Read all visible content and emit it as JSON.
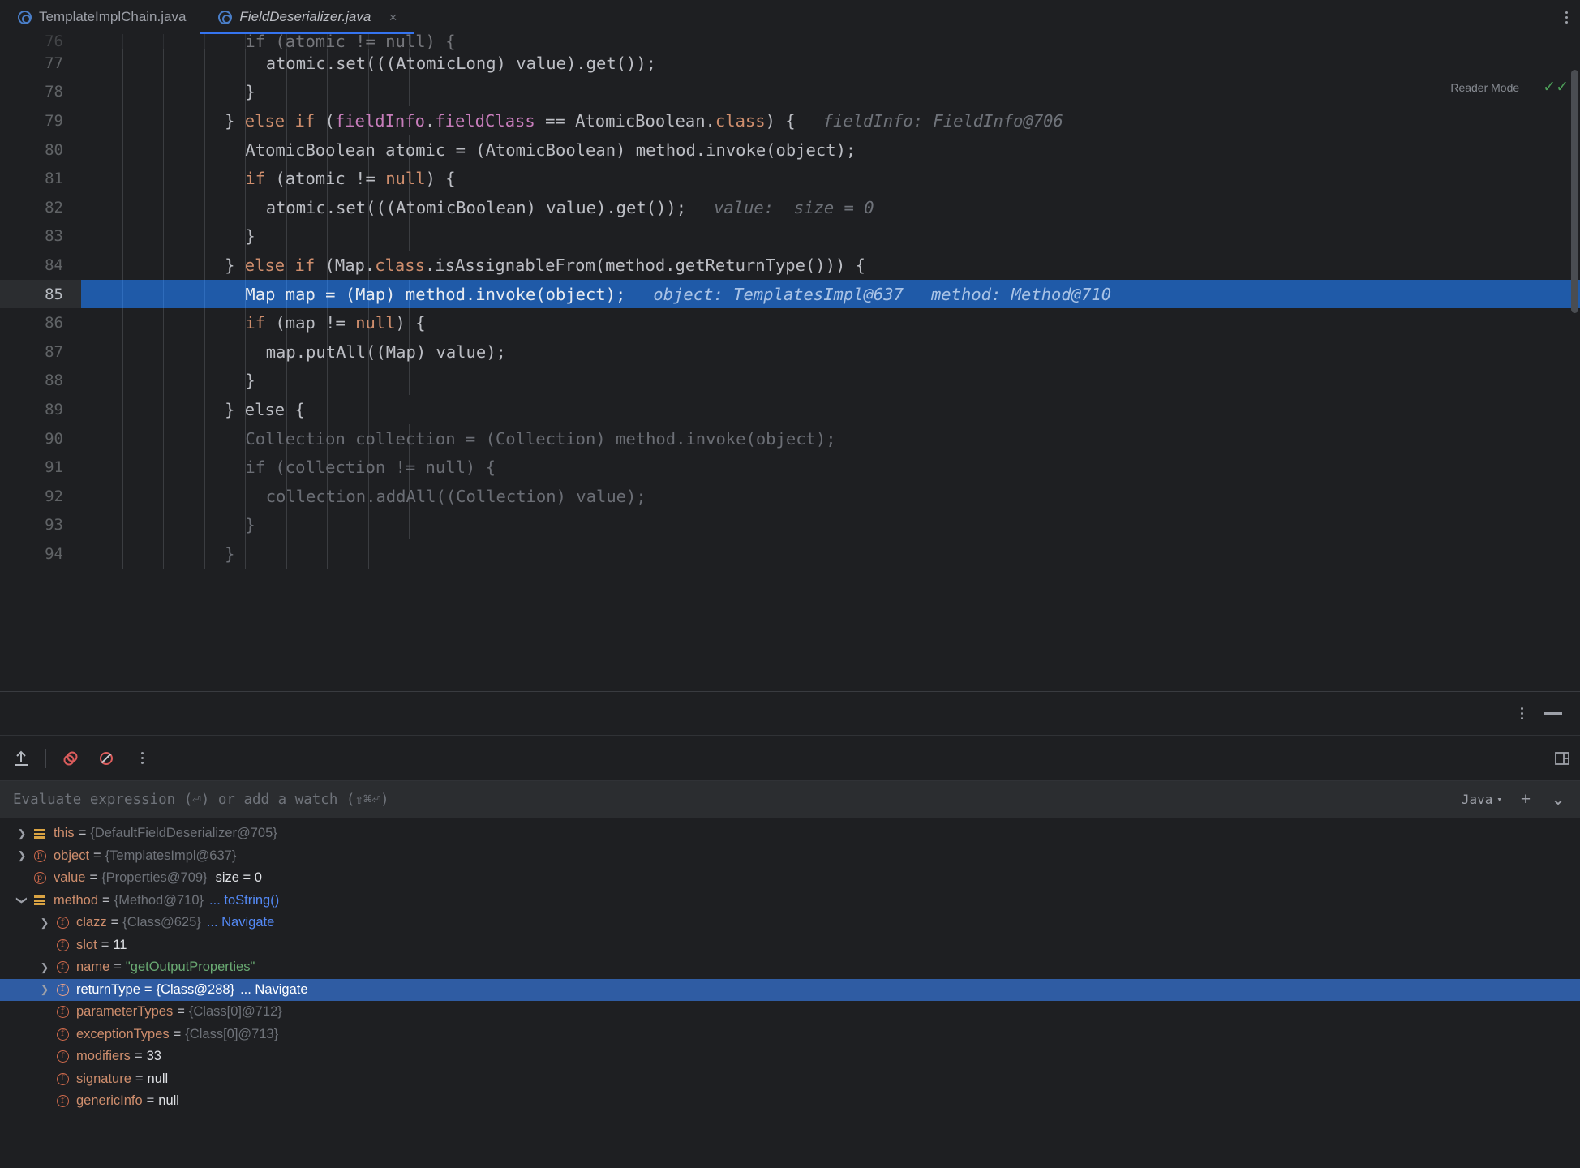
{
  "window": {
    "title": "IntelliJ IDEA Debugger"
  },
  "tabs": [
    {
      "label": "TemplateImplChain.java",
      "icon": "java-class-icon",
      "active": false,
      "closable": false
    },
    {
      "label": "FieldDeserializer.java",
      "icon": "java-class-icon",
      "active": true,
      "closable": true,
      "close_label": "×"
    }
  ],
  "tabbar": {
    "more_label": "more-tabs"
  },
  "editor": {
    "reader_mode_label": "Reader Mode",
    "reader_mode_check": "✓✓",
    "lines": [
      {
        "num": "76",
        "clipped": true,
        "indent": 8,
        "tokens": [
          {
            "t": "if (atomic != null) {",
            "c": "pln"
          }
        ],
        "hint": ""
      },
      {
        "num": "77",
        "indent": 9,
        "tokens": [
          {
            "t": "atomic.set(((AtomicLong) value).get());",
            "c": "pln"
          }
        ],
        "hint": ""
      },
      {
        "num": "78",
        "indent": 8,
        "tokens": [
          {
            "t": "}",
            "c": "pln"
          }
        ],
        "hint": ""
      },
      {
        "num": "79",
        "indent": 7,
        "tokens": [
          {
            "t": "} ",
            "c": "pln"
          },
          {
            "t": "else if",
            "c": "kw"
          },
          {
            "t": " (",
            "c": "pln"
          },
          {
            "t": "fieldInfo",
            "c": "fld"
          },
          {
            "t": ".",
            "c": "pln"
          },
          {
            "t": "fieldClass",
            "c": "fld"
          },
          {
            "t": " == AtomicBoolean.",
            "c": "pln"
          },
          {
            "t": "class",
            "c": "kw"
          },
          {
            "t": ") {",
            "c": "pln"
          }
        ],
        "hint": "fieldInfo: FieldInfo@706"
      },
      {
        "num": "80",
        "indent": 8,
        "tokens": [
          {
            "t": "AtomicBoolean atomic = (AtomicBoolean) method.invoke(object);",
            "c": "pln"
          }
        ],
        "hint": ""
      },
      {
        "num": "81",
        "indent": 8,
        "tokens": [
          {
            "t": "if",
            "c": "kw"
          },
          {
            "t": " (atomic != ",
            "c": "pln"
          },
          {
            "t": "null",
            "c": "kw"
          },
          {
            "t": ") {",
            "c": "pln"
          }
        ],
        "hint": ""
      },
      {
        "num": "82",
        "indent": 9,
        "tokens": [
          {
            "t": "atomic.set(((AtomicBoolean) value).get());",
            "c": "pln"
          }
        ],
        "hint": "value:  size = 0"
      },
      {
        "num": "83",
        "indent": 8,
        "tokens": [
          {
            "t": "}",
            "c": "pln"
          }
        ],
        "hint": ""
      },
      {
        "num": "84",
        "indent": 7,
        "tokens": [
          {
            "t": "} ",
            "c": "pln"
          },
          {
            "t": "else if",
            "c": "kw"
          },
          {
            "t": " (Map.",
            "c": "pln"
          },
          {
            "t": "class",
            "c": "kw"
          },
          {
            "t": ".isAssignableFrom(method.getReturnType())) {",
            "c": "pln"
          }
        ],
        "hint": ""
      },
      {
        "num": "85",
        "indent": 8,
        "highlight": true,
        "tokens": [
          {
            "t": "Map map = (Map) method.invoke(object);",
            "c": "pln"
          }
        ],
        "hint": "object: TemplatesImpl@637",
        "hint2": "method: Method@710"
      },
      {
        "num": "86",
        "indent": 8,
        "tokens": [
          {
            "t": "if",
            "c": "kw"
          },
          {
            "t": " (map != ",
            "c": "pln"
          },
          {
            "t": "null",
            "c": "kw"
          },
          {
            "t": ") {",
            "c": "pln"
          }
        ],
        "hint": ""
      },
      {
        "num": "87",
        "indent": 9,
        "tokens": [
          {
            "t": "map.putAll((Map) value);",
            "c": "pln"
          }
        ],
        "hint": ""
      },
      {
        "num": "88",
        "indent": 8,
        "tokens": [
          {
            "t": "}",
            "c": "pln"
          }
        ],
        "hint": ""
      },
      {
        "num": "89",
        "indent": 7,
        "tokens": [
          {
            "t": "} ",
            "c": "pln"
          },
          {
            "t": "else",
            "c": "pln"
          },
          {
            "t": " {",
            "c": "pln"
          }
        ],
        "hint": ""
      },
      {
        "num": "90",
        "indent": 8,
        "dim": true,
        "tokens": [
          {
            "t": "Collection collection = (Collection) method.invoke(object);",
            "c": "dim"
          }
        ],
        "hint": ""
      },
      {
        "num": "91",
        "indent": 8,
        "dim": true,
        "tokens": [
          {
            "t": "if (collection != null) {",
            "c": "dim"
          }
        ],
        "hint": ""
      },
      {
        "num": "92",
        "indent": 9,
        "dim": true,
        "tokens": [
          {
            "t": "collection.addAll((Collection) value);",
            "c": "dim"
          }
        ],
        "hint": ""
      },
      {
        "num": "93",
        "indent": 8,
        "dim": true,
        "tokens": [
          {
            "t": "}",
            "c": "dim"
          }
        ],
        "hint": ""
      },
      {
        "num": "94",
        "indent": 7,
        "dim": true,
        "tokens": [
          {
            "t": "}",
            "c": "dim"
          }
        ],
        "hint": ""
      }
    ]
  },
  "debugger": {
    "panel_more_label": "options",
    "minimize_label": "minimize",
    "toolbar": [
      {
        "name": "step-out-icon",
        "glyph": "↑"
      },
      {
        "name": "view-breakpoints-icon",
        "glyph": "○"
      },
      {
        "name": "mute-breakpoints-icon",
        "glyph": "⊘"
      },
      {
        "name": "more-options-icon",
        "glyph": "⋮"
      }
    ],
    "layout_icon": "layout-settings-icon",
    "evaluate": {
      "placeholder": "Evaluate expression (⏎) or add a watch (⇧⌘⏎)",
      "language": "Java",
      "add_watch_label": "+",
      "expand_label": "⌄"
    },
    "variables": [
      {
        "depth": 0,
        "expandable": true,
        "expanded": false,
        "icon": "frame-icon",
        "name": "this",
        "eq": "=",
        "value": "{DefaultFieldDeserializer@705}",
        "value_class": "vval-dim"
      },
      {
        "depth": 0,
        "expandable": true,
        "expanded": false,
        "icon": "parameter-icon",
        "name": "object",
        "eq": "=",
        "value": "{TemplatesImpl@637}",
        "value_class": "vval-dim"
      },
      {
        "depth": 0,
        "expandable": false,
        "icon": "parameter-icon",
        "name": "value",
        "eq": "=",
        "value": "{Properties@709}",
        "value_class": "vval-dim",
        "extra": "size = 0"
      },
      {
        "depth": 0,
        "expandable": true,
        "expanded": true,
        "icon": "frame-icon",
        "name": "method",
        "eq": "=",
        "value": "{Method@710}",
        "value_class": "vval-dim",
        "link": "... toString()"
      },
      {
        "depth": 1,
        "expandable": true,
        "expanded": false,
        "icon": "field-icon",
        "name": "clazz",
        "eq": "=",
        "value": "{Class@625}",
        "value_class": "vval-dim",
        "link": "... Navigate"
      },
      {
        "depth": 1,
        "expandable": false,
        "icon": "field-icon",
        "name": "slot",
        "eq": "=",
        "value": "11",
        "value_class": "vnum"
      },
      {
        "depth": 1,
        "expandable": true,
        "expanded": false,
        "icon": "field-icon",
        "name": "name",
        "eq": "=",
        "value": "\"getOutputProperties\"",
        "value_class": "vstr"
      },
      {
        "depth": 1,
        "expandable": true,
        "expanded": false,
        "icon": "field-icon",
        "selected": true,
        "name": "returnType",
        "eq": "=",
        "value": "{Class@288}",
        "value_class": "vval",
        "link": "... Navigate"
      },
      {
        "depth": 1,
        "expandable": false,
        "icon": "field-icon",
        "name": "parameterTypes",
        "eq": "=",
        "value": "{Class[0]@712}",
        "value_class": "vval-dim"
      },
      {
        "depth": 1,
        "expandable": false,
        "icon": "field-icon",
        "name": "exceptionTypes",
        "eq": "=",
        "value": "{Class[0]@713}",
        "value_class": "vval-dim"
      },
      {
        "depth": 1,
        "expandable": false,
        "icon": "field-icon",
        "name": "modifiers",
        "eq": "=",
        "value": "33",
        "value_class": "vnum"
      },
      {
        "depth": 1,
        "expandable": false,
        "icon": "field-icon",
        "name": "signature",
        "eq": "=",
        "value": "null",
        "value_class": "vnum"
      },
      {
        "depth": 1,
        "expandable": false,
        "icon": "field-icon",
        "name": "genericInfo",
        "eq": "=",
        "value": "null",
        "value_class": "vnum"
      }
    ]
  },
  "colors": {
    "background": "#1e1f22",
    "panel": "#2b2d30",
    "accent_blue": "#3574f0",
    "selection_blue": "#2f5ca3",
    "line_highlight": "#1f5aa8",
    "keyword_orange": "#cf8e6d",
    "field_purple": "#c77dbb",
    "string_green": "#6aab73",
    "link_blue": "#548af7"
  }
}
